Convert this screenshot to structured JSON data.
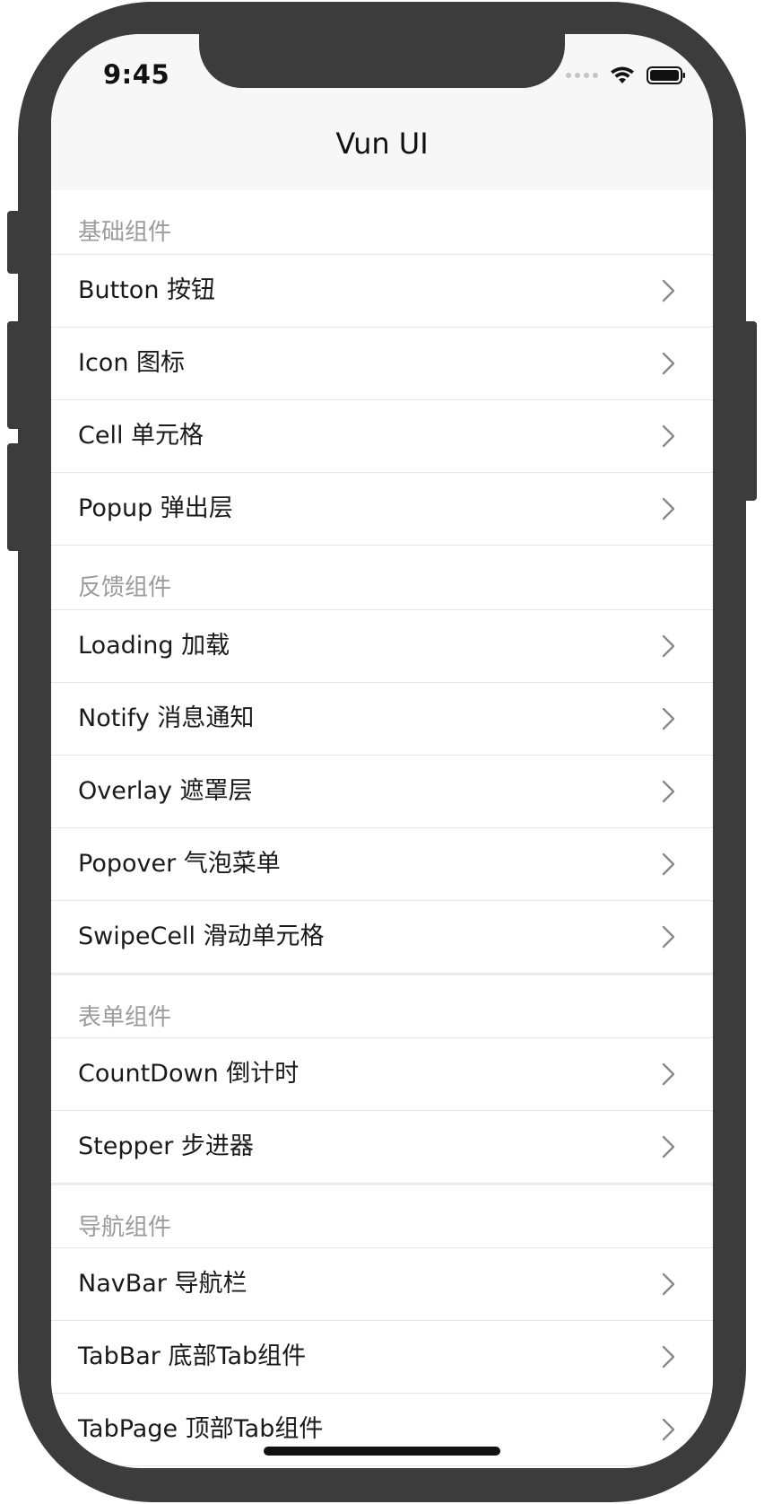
{
  "status": {
    "time": "9:45"
  },
  "nav": {
    "title": "Vun UI"
  },
  "sections": [
    {
      "header": "基础组件",
      "items": [
        "Button 按钮",
        "Icon 图标",
        "Cell 单元格",
        "Popup 弹出层"
      ]
    },
    {
      "header": "反馈组件",
      "items": [
        "Loading 加载",
        "Notify 消息通知",
        "Overlay 遮罩层",
        "Popover 气泡菜单",
        "SwipeCell 滑动单元格"
      ]
    },
    {
      "header": "表单组件",
      "items": [
        "CountDown 倒计时",
        "Stepper 步进器"
      ]
    },
    {
      "header": "导航组件",
      "items": [
        "NavBar 导航栏",
        "TabBar 底部Tab组件",
        "TabPage 顶部Tab组件"
      ]
    }
  ],
  "icons": {
    "row_arrow": "chevron-right-icon",
    "status": [
      "signal-icon",
      "wifi-icon",
      "battery-icon"
    ]
  },
  "colors": {
    "nav_bg": "#f7f7f7",
    "section_text": "#9b9b9b",
    "frame": "#3c3c3c"
  }
}
